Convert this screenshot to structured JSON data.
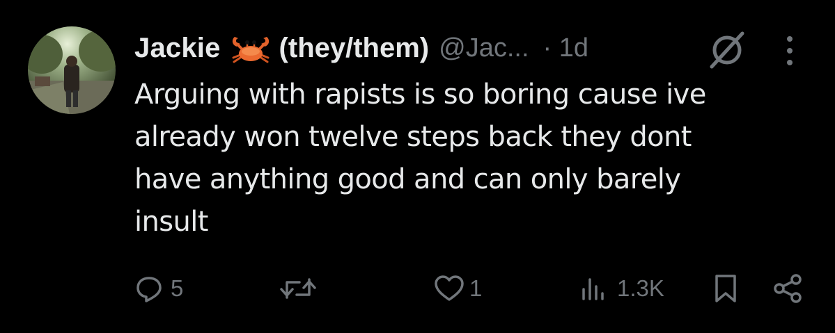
{
  "tweet": {
    "author": {
      "display_name": "Jackie",
      "emoji_icon": "crab-emoji",
      "pronouns": "(they/them)",
      "handle": "@Jac...",
      "time": "· 1d"
    },
    "text": "Arguing with rapists is so boring cause ive\nalready won twelve steps back they dont\nhave anything good and can only barely\ninsult",
    "actions": {
      "reply_count": "5",
      "retweet_count": "",
      "like_count": "1",
      "views_count": "1.3K"
    },
    "icons": {
      "reply": "reply-icon",
      "retweet": "retweet-icon",
      "like": "heart-icon",
      "views": "views-chart-icon",
      "bookmark": "bookmark-icon",
      "share": "share-icon",
      "more": "more-vertical-icon",
      "badge": "slash-circle-icon"
    },
    "colors": {
      "background": "#000000",
      "text": "#e7e9ea",
      "muted": "#71767b"
    }
  }
}
